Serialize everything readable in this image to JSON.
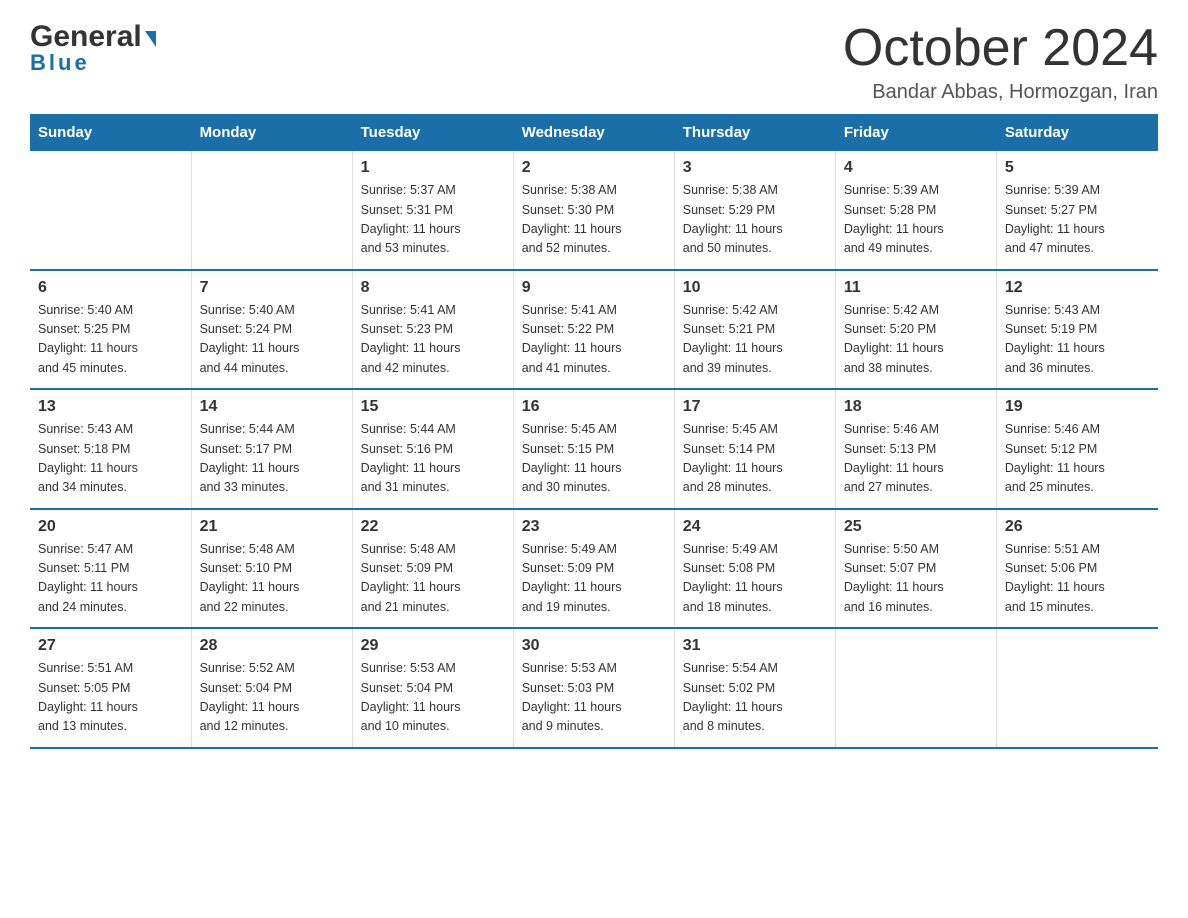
{
  "logo": {
    "line1": "General",
    "triangle": "▶",
    "line2": "Blue"
  },
  "title": "October 2024",
  "subtitle": "Bandar Abbas, Hormozgan, Iran",
  "days_header": [
    "Sunday",
    "Monday",
    "Tuesday",
    "Wednesday",
    "Thursday",
    "Friday",
    "Saturday"
  ],
  "weeks": [
    [
      {
        "day": "",
        "info": ""
      },
      {
        "day": "",
        "info": ""
      },
      {
        "day": "1",
        "info": "Sunrise: 5:37 AM\nSunset: 5:31 PM\nDaylight: 11 hours\nand 53 minutes."
      },
      {
        "day": "2",
        "info": "Sunrise: 5:38 AM\nSunset: 5:30 PM\nDaylight: 11 hours\nand 52 minutes."
      },
      {
        "day": "3",
        "info": "Sunrise: 5:38 AM\nSunset: 5:29 PM\nDaylight: 11 hours\nand 50 minutes."
      },
      {
        "day": "4",
        "info": "Sunrise: 5:39 AM\nSunset: 5:28 PM\nDaylight: 11 hours\nand 49 minutes."
      },
      {
        "day": "5",
        "info": "Sunrise: 5:39 AM\nSunset: 5:27 PM\nDaylight: 11 hours\nand 47 minutes."
      }
    ],
    [
      {
        "day": "6",
        "info": "Sunrise: 5:40 AM\nSunset: 5:25 PM\nDaylight: 11 hours\nand 45 minutes."
      },
      {
        "day": "7",
        "info": "Sunrise: 5:40 AM\nSunset: 5:24 PM\nDaylight: 11 hours\nand 44 minutes."
      },
      {
        "day": "8",
        "info": "Sunrise: 5:41 AM\nSunset: 5:23 PM\nDaylight: 11 hours\nand 42 minutes."
      },
      {
        "day": "9",
        "info": "Sunrise: 5:41 AM\nSunset: 5:22 PM\nDaylight: 11 hours\nand 41 minutes."
      },
      {
        "day": "10",
        "info": "Sunrise: 5:42 AM\nSunset: 5:21 PM\nDaylight: 11 hours\nand 39 minutes."
      },
      {
        "day": "11",
        "info": "Sunrise: 5:42 AM\nSunset: 5:20 PM\nDaylight: 11 hours\nand 38 minutes."
      },
      {
        "day": "12",
        "info": "Sunrise: 5:43 AM\nSunset: 5:19 PM\nDaylight: 11 hours\nand 36 minutes."
      }
    ],
    [
      {
        "day": "13",
        "info": "Sunrise: 5:43 AM\nSunset: 5:18 PM\nDaylight: 11 hours\nand 34 minutes."
      },
      {
        "day": "14",
        "info": "Sunrise: 5:44 AM\nSunset: 5:17 PM\nDaylight: 11 hours\nand 33 minutes."
      },
      {
        "day": "15",
        "info": "Sunrise: 5:44 AM\nSunset: 5:16 PM\nDaylight: 11 hours\nand 31 minutes."
      },
      {
        "day": "16",
        "info": "Sunrise: 5:45 AM\nSunset: 5:15 PM\nDaylight: 11 hours\nand 30 minutes."
      },
      {
        "day": "17",
        "info": "Sunrise: 5:45 AM\nSunset: 5:14 PM\nDaylight: 11 hours\nand 28 minutes."
      },
      {
        "day": "18",
        "info": "Sunrise: 5:46 AM\nSunset: 5:13 PM\nDaylight: 11 hours\nand 27 minutes."
      },
      {
        "day": "19",
        "info": "Sunrise: 5:46 AM\nSunset: 5:12 PM\nDaylight: 11 hours\nand 25 minutes."
      }
    ],
    [
      {
        "day": "20",
        "info": "Sunrise: 5:47 AM\nSunset: 5:11 PM\nDaylight: 11 hours\nand 24 minutes."
      },
      {
        "day": "21",
        "info": "Sunrise: 5:48 AM\nSunset: 5:10 PM\nDaylight: 11 hours\nand 22 minutes."
      },
      {
        "day": "22",
        "info": "Sunrise: 5:48 AM\nSunset: 5:09 PM\nDaylight: 11 hours\nand 21 minutes."
      },
      {
        "day": "23",
        "info": "Sunrise: 5:49 AM\nSunset: 5:09 PM\nDaylight: 11 hours\nand 19 minutes."
      },
      {
        "day": "24",
        "info": "Sunrise: 5:49 AM\nSunset: 5:08 PM\nDaylight: 11 hours\nand 18 minutes."
      },
      {
        "day": "25",
        "info": "Sunrise: 5:50 AM\nSunset: 5:07 PM\nDaylight: 11 hours\nand 16 minutes."
      },
      {
        "day": "26",
        "info": "Sunrise: 5:51 AM\nSunset: 5:06 PM\nDaylight: 11 hours\nand 15 minutes."
      }
    ],
    [
      {
        "day": "27",
        "info": "Sunrise: 5:51 AM\nSunset: 5:05 PM\nDaylight: 11 hours\nand 13 minutes."
      },
      {
        "day": "28",
        "info": "Sunrise: 5:52 AM\nSunset: 5:04 PM\nDaylight: 11 hours\nand 12 minutes."
      },
      {
        "day": "29",
        "info": "Sunrise: 5:53 AM\nSunset: 5:04 PM\nDaylight: 11 hours\nand 10 minutes."
      },
      {
        "day": "30",
        "info": "Sunrise: 5:53 AM\nSunset: 5:03 PM\nDaylight: 11 hours\nand 9 minutes."
      },
      {
        "day": "31",
        "info": "Sunrise: 5:54 AM\nSunset: 5:02 PM\nDaylight: 11 hours\nand 8 minutes."
      },
      {
        "day": "",
        "info": ""
      },
      {
        "day": "",
        "info": ""
      }
    ]
  ]
}
